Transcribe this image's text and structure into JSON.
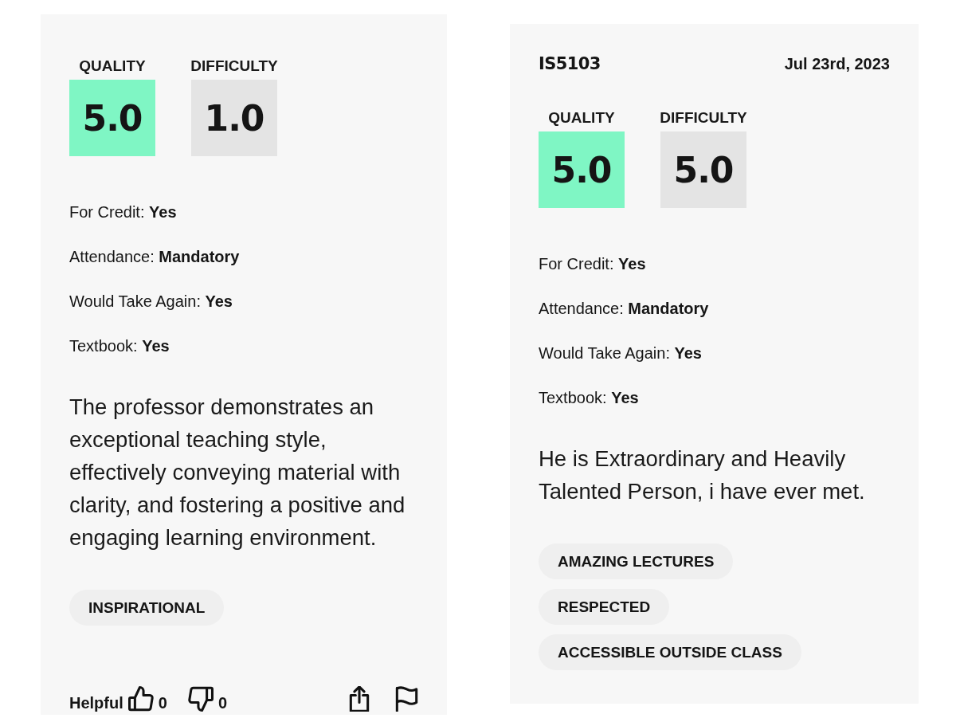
{
  "reviews": [
    {
      "ratings": [
        {
          "label": "QUALITY",
          "value": "5.0",
          "color": "#7ff6c4"
        },
        {
          "label": "DIFFICULTY",
          "value": "1.0",
          "color": "#e4e4e4"
        }
      ],
      "details": [
        "For Credit: **Yes**",
        "Attendance: **Mandatory**",
        "Would Take Again: **Yes**",
        "Textbook: **Yes**"
      ],
      "comment": "The professor demonstrates an exceptional teaching style, effectively conveying material with clarity, and fostering a positive and engaging learning environment.",
      "tags": [
        "INSPIRATIONAL"
      ],
      "footer": {
        "helpful_label": "Helpful",
        "likes": "0",
        "dislikes": "0"
      }
    },
    {
      "course": "IS5103",
      "date": "Jul 23rd, 2023",
      "ratings": [
        {
          "label": "QUALITY",
          "value": "5.0",
          "color": "#7ff6c4"
        },
        {
          "label": "DIFFICULTY",
          "value": "5.0",
          "color": "#e4e4e4"
        }
      ],
      "details": [
        "For Credit: **Yes**",
        "Attendance: **Mandatory**",
        "Would Take Again: **Yes**",
        "Textbook: **Yes**"
      ],
      "comment": "He is Extraordinary and Heavily Talented Person, i have ever met.",
      "tags": [
        "AMAZING LECTURES",
        "RESPECTED",
        "ACCESSIBLE OUTSIDE CLASS"
      ]
    }
  ]
}
